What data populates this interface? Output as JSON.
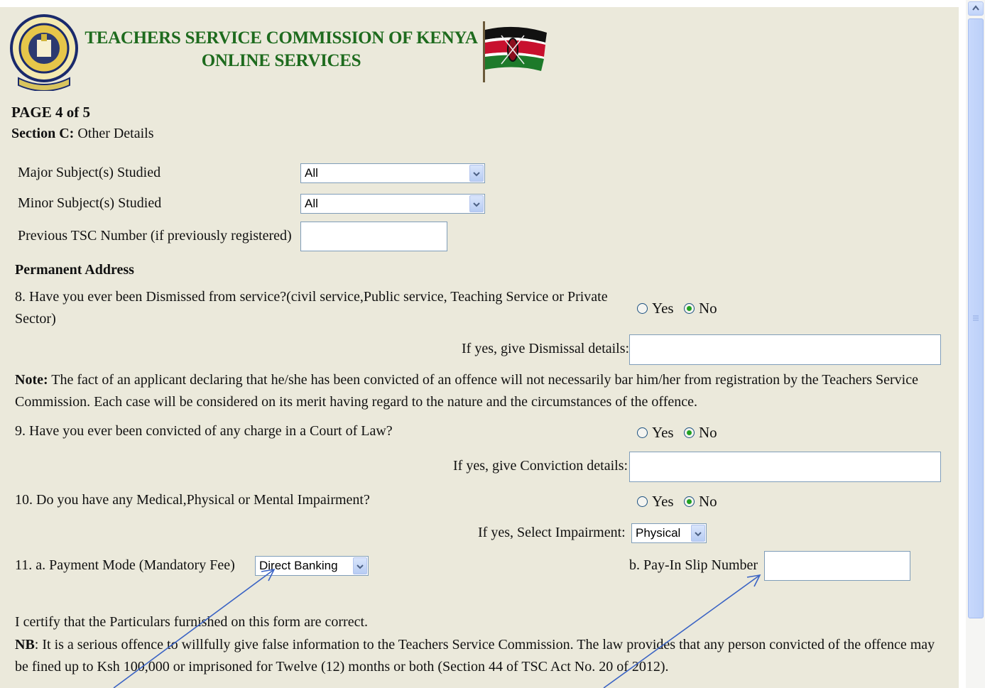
{
  "header": {
    "org_line1": "TEACHERS SERVICE COMMISSION OF KENYA",
    "org_line2": "ONLINE SERVICES"
  },
  "page": {
    "indicator": "PAGE 4 of 5",
    "section_bold": "Section C:",
    "section_name": " Other Details"
  },
  "subjects": {
    "major_label": "Major Subject(s) Studied",
    "major_value": "All",
    "minor_label": "Minor Subject(s) Studied",
    "minor_value": "All",
    "prev_tsc_label": "Previous TSC Number (if previously registered)",
    "prev_tsc_value": ""
  },
  "permanent_address_heading": "Permanent Address",
  "q8": {
    "text": "8. Have you ever been Dismissed from service?(civil service,Public service, Teaching Service or Private Sector)",
    "yes": "Yes",
    "no": "No",
    "details_label": "If yes, give Dismissal details:",
    "details_value": ""
  },
  "note": {
    "bold": "Note:",
    "text": " The fact of an applicant declaring that he/she has been convicted of an offence will not necessarily bar him/her from registration by the Teachers Service Commission. Each case will be considered on its merit having  regard to the nature and the circumstances of the offence."
  },
  "q9": {
    "text": "9. Have you ever been convicted of any charge in a Court of Law?",
    "yes": "Yes",
    "no": "No",
    "details_label": "If yes, give Conviction details:",
    "details_value": ""
  },
  "q10": {
    "text": "10. Do you have any Medical,Physical or Mental Impairment?",
    "yes": "Yes",
    "no": "No",
    "impairment_label": "If yes, Select Impairment:",
    "impairment_value": "Physical"
  },
  "q11": {
    "payment_label": "11. a. Payment Mode (Mandatory Fee)",
    "payment_value": "Direct Banking",
    "slip_label": "b. Pay-In Slip Number",
    "slip_value": ""
  },
  "certify": "I certify that the Particulars furnished on this form are correct.",
  "nb": {
    "bold": "NB",
    "text": ": It is a serious offence to willfully give false information to the Teachers Service Commission. The law provides that any person convicted of the offence may be fined up to Ksh 100,000 or imprisoned for Twelve (12) months or both (Section 44 of TSC Act No. 20 of 2012)."
  },
  "colors": {
    "background": "#ebe9db",
    "title_green": "#1e6b1e",
    "annotation_arrow": "#3a63c4"
  }
}
